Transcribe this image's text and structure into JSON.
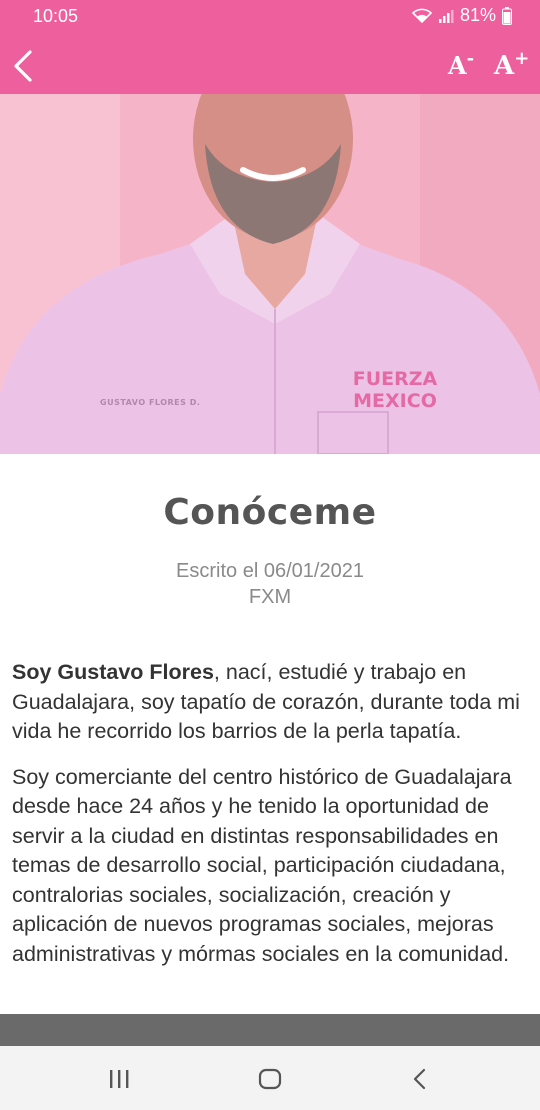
{
  "status_bar": {
    "time": "10:05",
    "battery": "81%"
  },
  "toolbar": {
    "font_decrease": "A",
    "font_decrease_sup": "-",
    "font_increase": "A",
    "font_increase_sup": "+"
  },
  "hero": {
    "shirt_name": "GUSTAVO FLORES D.",
    "logo_line1": "FUERZA",
    "logo_line2": "MEXICO"
  },
  "article": {
    "title": "Conóceme",
    "written_on": "Escrito el 06/01/2021",
    "author": "FXM",
    "p1_bold": "Soy Gustavo Flores",
    "p1_rest": ", nací, estudié y trabajo en Guadalajara, soy tapatío de corazón, durante toda mi vida he recorrido los barrios de la perla tapatía.",
    "p2": "Soy comerciante del centro histórico de Guadalajara desde hace 24 años y he tenido la oportunidad de servir a la ciudad en distintas responsabilidades en temas de desarrollo social, participación ciudadana, contralorias sociales, socialización, creación y aplicación de nuevos programas sociales, mejoras administrativas y mórmas sociales en la comunidad."
  },
  "colors": {
    "header": "#ee5f9e",
    "hero_tint": "#f6b5c9",
    "title": "#555555",
    "meta": "#8a8a8a"
  },
  "icons": [
    "back-arrow-icon",
    "wifi-icon",
    "signal-icon",
    "battery-icon",
    "recents-icon",
    "home-icon",
    "nav-back-icon"
  ]
}
